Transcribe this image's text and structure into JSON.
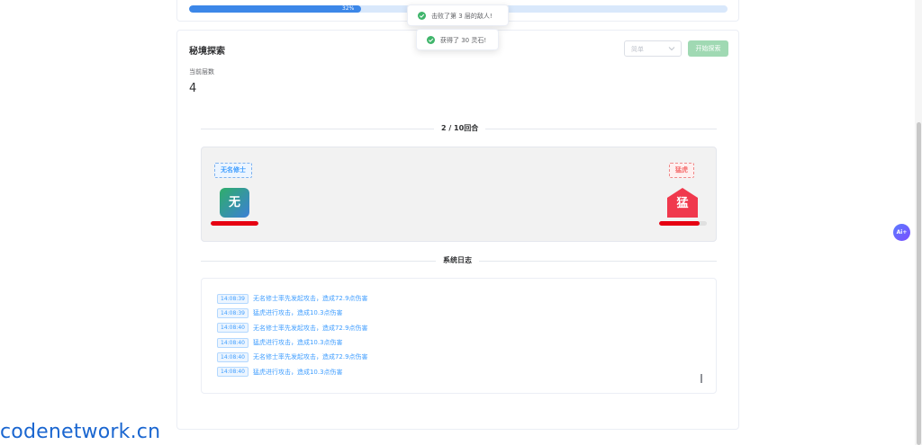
{
  "progress": {
    "percent": 32,
    "label": "32%"
  },
  "card": {
    "title": "秘境探索",
    "difficulty_placeholder": "简单",
    "start_button": "开始探索",
    "floor_label": "当前层数",
    "floor_value": "4"
  },
  "battle": {
    "round_label": "2 / 10回合",
    "player": {
      "name": "无名修士",
      "avatar_char": "无",
      "hp_fraction": 1.0
    },
    "enemy": {
      "name": "猛虎",
      "avatar_char": "猛",
      "hp_fraction": 0.85
    }
  },
  "log": {
    "title": "系统日志",
    "entries": [
      {
        "time": "14:08:39",
        "text": "无名修士率先发起攻击，造成72.9点伤害"
      },
      {
        "time": "14:08:39",
        "text": "猛虎进行攻击，造成10.3点伤害"
      },
      {
        "time": "14:08:40",
        "text": "无名修士率先发起攻击，造成72.9点伤害"
      },
      {
        "time": "14:08:40",
        "text": "猛虎进行攻击，造成10.3点伤害"
      },
      {
        "time": "14:08:40",
        "text": "无名修士率先发起攻击，造成72.9点伤害"
      },
      {
        "time": "14:08:40",
        "text": "猛虎进行攻击，造成10.3点伤害"
      }
    ]
  },
  "toasts": [
    {
      "text": "击败了第 3 层的敌人!"
    },
    {
      "text": "获得了 30 灵石!"
    }
  ],
  "ai_badge": "Ai+",
  "watermark": "codenetwork.cn",
  "colors": {
    "primary": "#409eff",
    "success": "#3fb56b",
    "danger": "#e60012",
    "enemy_avatar": "#f0394d"
  }
}
